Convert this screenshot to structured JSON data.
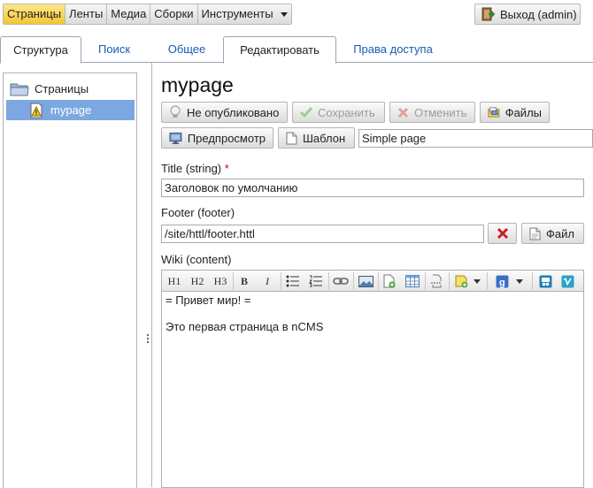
{
  "topmenu": {
    "items": [
      {
        "label": "Страницы",
        "active": true
      },
      {
        "label": "Ленты"
      },
      {
        "label": "Медиа"
      },
      {
        "label": "Сборки"
      },
      {
        "label": "Инструменты",
        "dropdown": true
      }
    ],
    "logout_label": "Выход (admin)"
  },
  "tabs": [
    {
      "label": "Структура",
      "active": true
    },
    {
      "label": "Поиск"
    },
    {
      "label": "Общее"
    },
    {
      "label": "Редактировать",
      "active": true
    },
    {
      "label": "Права доступа"
    }
  ],
  "tree": {
    "root_label": "Страницы",
    "selected_label": "mypage"
  },
  "page": {
    "title": "mypage",
    "buttons": {
      "unpublished": "Не опубликовано",
      "save": "Сохранить",
      "cancel": "Отменить",
      "files": "Файлы",
      "preview": "Предпросмотр",
      "template": "Шаблон"
    },
    "template_value": "Simple page"
  },
  "fields": {
    "title": {
      "label": "Title (string)",
      "required": "*",
      "value": "Заголовок по умолчанию"
    },
    "footer": {
      "label": "Footer (footer)",
      "value": "/site/httl/footer.httl",
      "file_button": "Файл"
    },
    "wiki": {
      "label": "Wiki (content)",
      "toolbar": {
        "h1": "H1",
        "h2": "H2",
        "h3": "H3",
        "bold": "B",
        "italic": "I"
      },
      "lines": [
        "= Привет мир! =",
        "",
        "Это первая страница в nCMS"
      ]
    }
  },
  "colors": {
    "menu_active": "#f5c632",
    "tab_link": "#1a5bb5",
    "tree_selected": "#7ca7e0",
    "required": "#d40000"
  }
}
